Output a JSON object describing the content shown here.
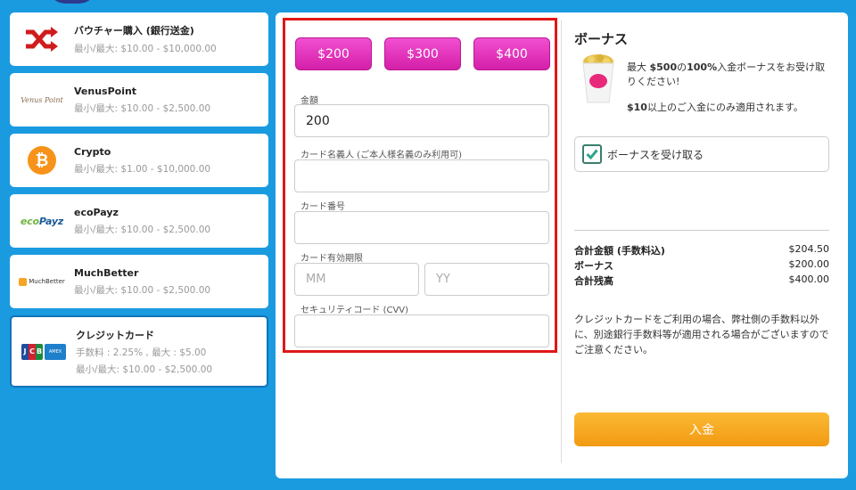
{
  "methods": [
    {
      "name": "バウチャー購入 (銀行送金)",
      "limit": "最小/最大: $10.00 - $10,000.00",
      "logo": "shuffle-icon"
    },
    {
      "name": "VenusPoint",
      "limit": "最小/最大: $10.00 - $2,500.00",
      "logo_text": "Venus Point"
    },
    {
      "name": "Crypto",
      "limit": "最小/最大: $1.00 - $10,000.00",
      "logo": "bitcoin-icon"
    },
    {
      "name": "ecoPayz",
      "limit": "最小/最大: $10.00 - $2,500.00",
      "logo_text_a": "eco",
      "logo_text_b": "Payz"
    },
    {
      "name": "MuchBetter",
      "limit": "最小/最大: $10.00 - $2,500.00",
      "logo_text": "MuchBetter"
    },
    {
      "name": "クレジットカード",
      "fee": "手数料 : 2.25% , 最大 : $5.00",
      "limit": "最小/最大: $10.00 - $2,500.00",
      "logo": "jcb-amex-icons",
      "selected": true
    }
  ],
  "form": {
    "amount_buttons": [
      "$200",
      "$300",
      "$400"
    ],
    "amount_label": "金額",
    "amount_value": "200",
    "cardholder_label": "カード名義人 (ご本人様名義のみ利用可)",
    "cardholder_value": "",
    "card_number_label": "カード番号",
    "card_number_value": "",
    "expiry_label": "カード有効期限",
    "expiry_month_placeholder": "MM",
    "expiry_year_placeholder": "YY",
    "cvv_label": "セキュリティコード (CVV)",
    "cvv_value": ""
  },
  "bonus": {
    "title": "ボーナス",
    "text_pre": "最大 ",
    "text_amount": "$500",
    "text_mid": "の",
    "text_percent": "100%",
    "text_post": "入金ボーナスをお受け取りください!",
    "note_amount": "$10",
    "note_post": "以上のご入金にのみ適用されます。",
    "accept_label": "ボーナスを受け取る",
    "accept_checked": true
  },
  "summary": {
    "total_label": "合計金額 (手数料込)",
    "total_value": "$204.50",
    "bonus_label": "ボーナス",
    "bonus_value": "$200.00",
    "balance_label": "合計残高",
    "balance_value": "$400.00"
  },
  "info_text": "クレジットカードをご利用の場合、弊社側の手数料以外に、別途銀行手数料等が適用される場合がございますのでご注意ください。",
  "deposit_label": "入金",
  "colors": {
    "background": "#1a9be0",
    "accent_pink": "#e033bf",
    "deposit_orange": "#f5a623",
    "highlight_red": "#e01717"
  }
}
